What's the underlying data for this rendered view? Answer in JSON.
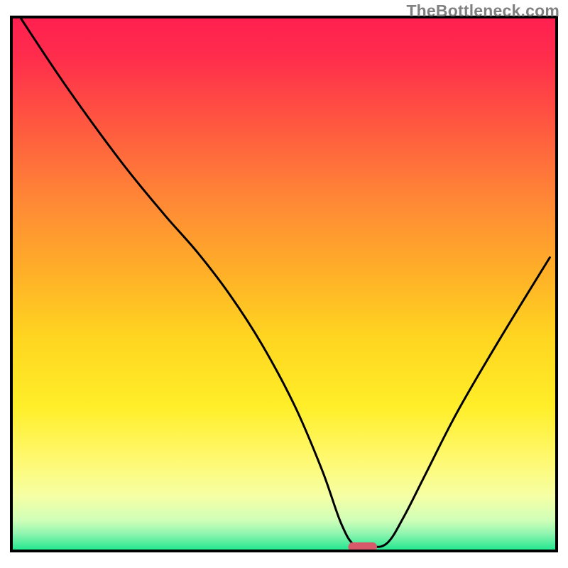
{
  "attribution": "TheBottleneck.com",
  "chart_data": {
    "type": "line",
    "title": "",
    "xlabel": "",
    "ylabel": "",
    "xlim": [
      0,
      100
    ],
    "ylim": [
      0,
      100
    ],
    "background_gradient": {
      "stops": [
        {
          "pos": 0.0,
          "color": "#ff2050"
        },
        {
          "pos": 0.07,
          "color": "#ff2c4c"
        },
        {
          "pos": 0.2,
          "color": "#ff5840"
        },
        {
          "pos": 0.35,
          "color": "#ff8a35"
        },
        {
          "pos": 0.48,
          "color": "#ffb028"
        },
        {
          "pos": 0.6,
          "color": "#ffd520"
        },
        {
          "pos": 0.73,
          "color": "#ffee28"
        },
        {
          "pos": 0.83,
          "color": "#fff970"
        },
        {
          "pos": 0.9,
          "color": "#f5ffa5"
        },
        {
          "pos": 0.945,
          "color": "#d0ffb8"
        },
        {
          "pos": 0.97,
          "color": "#90f5b0"
        },
        {
          "pos": 1.0,
          "color": "#25e890"
        }
      ]
    },
    "series": [
      {
        "name": "bottleneck-curve",
        "color": "#000000",
        "x": [
          1.5,
          10,
          20,
          28,
          34,
          40,
          46,
          52,
          57,
          60.5,
          63,
          66,
          69,
          72,
          76,
          82,
          90,
          99
        ],
        "y": [
          100,
          87,
          73,
          63,
          56,
          48,
          38.5,
          27,
          15,
          5,
          0.8,
          0.5,
          1.2,
          6,
          14,
          26,
          40,
          55
        ]
      }
    ],
    "marker": {
      "name": "optimal-zone",
      "x_center": 64.5,
      "y": 0.5,
      "width": 5.3,
      "height": 1.7,
      "color": "#d85a6a"
    },
    "frame": {
      "color": "#000000",
      "width": 4
    }
  }
}
